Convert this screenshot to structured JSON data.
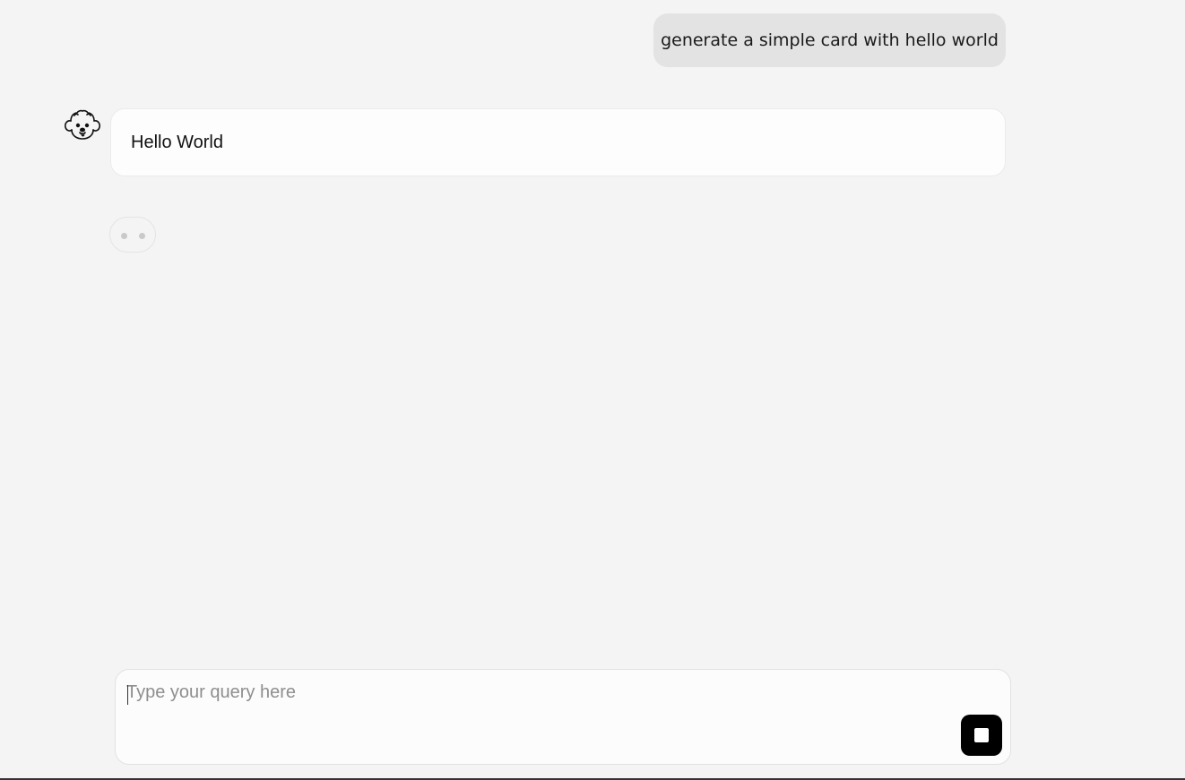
{
  "conversation": {
    "user_message": "generate a simple card with hello world",
    "assistant_card_text": "Hello World",
    "assistant_avatar_icon": "poodle-dog-icon",
    "typing_indicator_icon": "typing-dots-icon"
  },
  "composer": {
    "placeholder": "Type your query here",
    "value": "",
    "stop_icon": "stop-square-icon"
  },
  "colors": {
    "background": "#f4f4f4",
    "user_bubble": "#e3e3e3",
    "card": "#fdfdfd",
    "stop_button": "#000000"
  }
}
